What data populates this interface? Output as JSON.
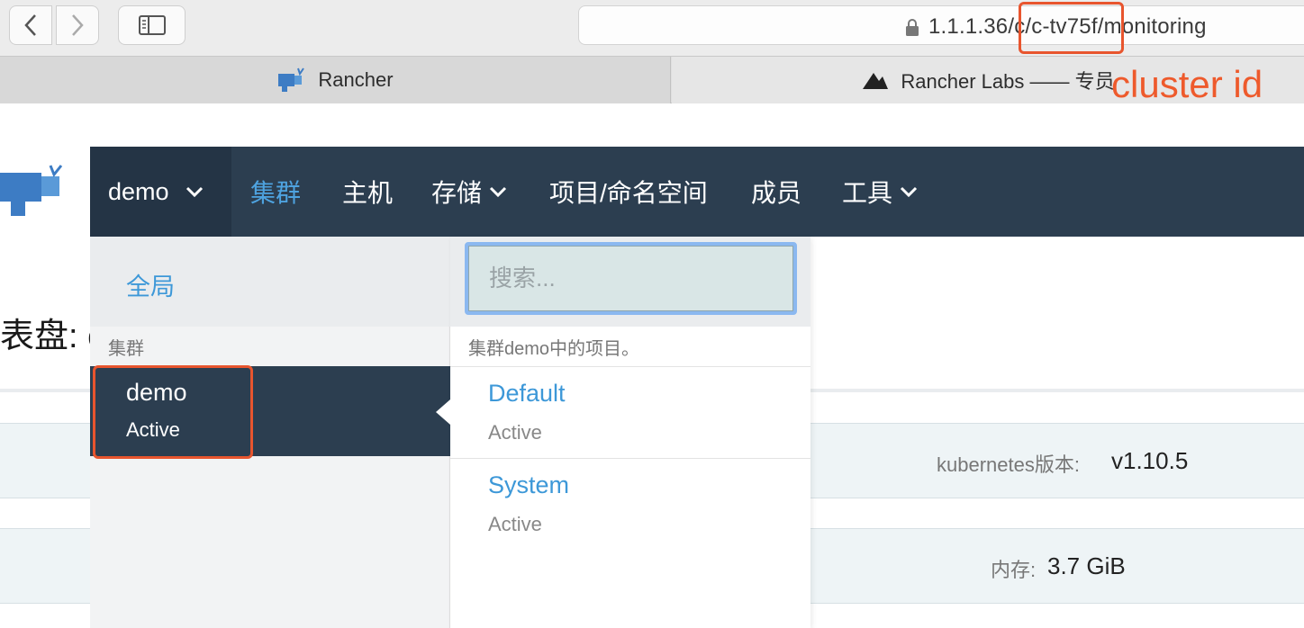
{
  "browser": {
    "url": "1.1.1.36/c/c-tv75f/monitoring",
    "tabs": [
      {
        "label": "Rancher"
      },
      {
        "label": "Rancher Labs —— 专员"
      }
    ]
  },
  "annotation": {
    "label": "cluster id",
    "color": "#e8552e"
  },
  "app_nav": {
    "cluster_name": "demo",
    "items": [
      {
        "label": "集群",
        "active": true,
        "has_dropdown": false
      },
      {
        "label": "主机",
        "active": false,
        "has_dropdown": false
      },
      {
        "label": "存储",
        "active": false,
        "has_dropdown": true
      },
      {
        "label": "项目/命名空间",
        "active": false,
        "has_dropdown": false
      },
      {
        "label": "成员",
        "active": false,
        "has_dropdown": false
      },
      {
        "label": "工具",
        "active": false,
        "has_dropdown": true
      }
    ]
  },
  "page": {
    "title_fragment": "表盘: c",
    "kubernetes_label": "kubernetes版本:",
    "kubernetes_value": "v1.10.5",
    "memory_label": "内存:",
    "memory_value": "3.7 GiB"
  },
  "dropdown": {
    "global_label": "全局",
    "cluster_section": "集群",
    "cluster": {
      "name": "demo",
      "state": "Active"
    },
    "search_placeholder": "搜索...",
    "projects_caption": "集群demo中的项目。",
    "projects": [
      {
        "name": "Default",
        "state": "Active"
      },
      {
        "name": "System",
        "state": "Active"
      }
    ]
  },
  "colors": {
    "nav_bg": "#2c3e50",
    "accent": "#3d98d8",
    "annotation": "#e8552e"
  }
}
